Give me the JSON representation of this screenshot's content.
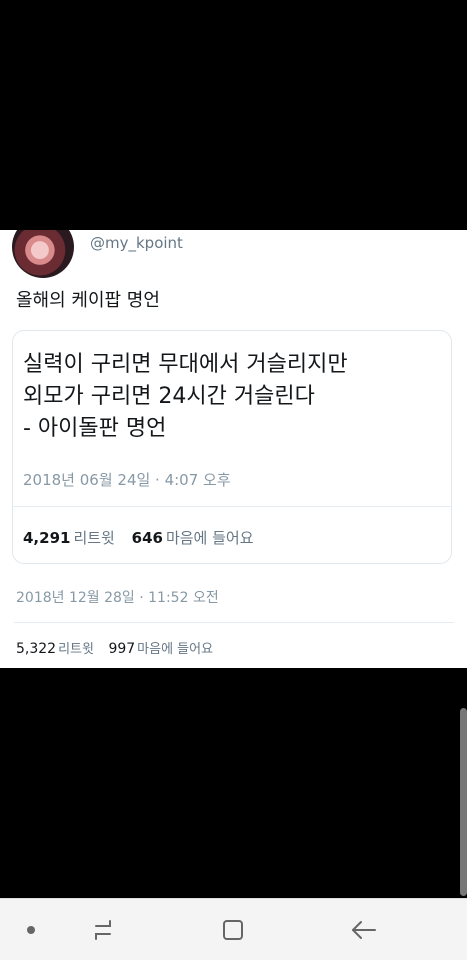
{
  "tweet": {
    "handle": "@my_kpoint",
    "text": "올해의 케이팝 명언",
    "timestamp": "2018년 12월 28일 · 11:52 오전",
    "retweets": "5,322",
    "retweets_label": "리트윗",
    "likes": "997",
    "likes_label": "마음에 들어요"
  },
  "quoted": {
    "text": "실력이 구리면 무대에서 거슬리지만\n외모가 구리면 24시간 거슬린다\n- 아이돌판 명언",
    "timestamp": "2018년 06월 24일 · 4:07 오후",
    "retweets": "4,291",
    "retweets_label": "리트윗",
    "likes": "646",
    "likes_label": "마음에 들어요"
  },
  "nav": {
    "icons": [
      "dot-icon",
      "recent-apps-icon",
      "home-icon",
      "back-icon"
    ],
    "color": "#666666"
  }
}
